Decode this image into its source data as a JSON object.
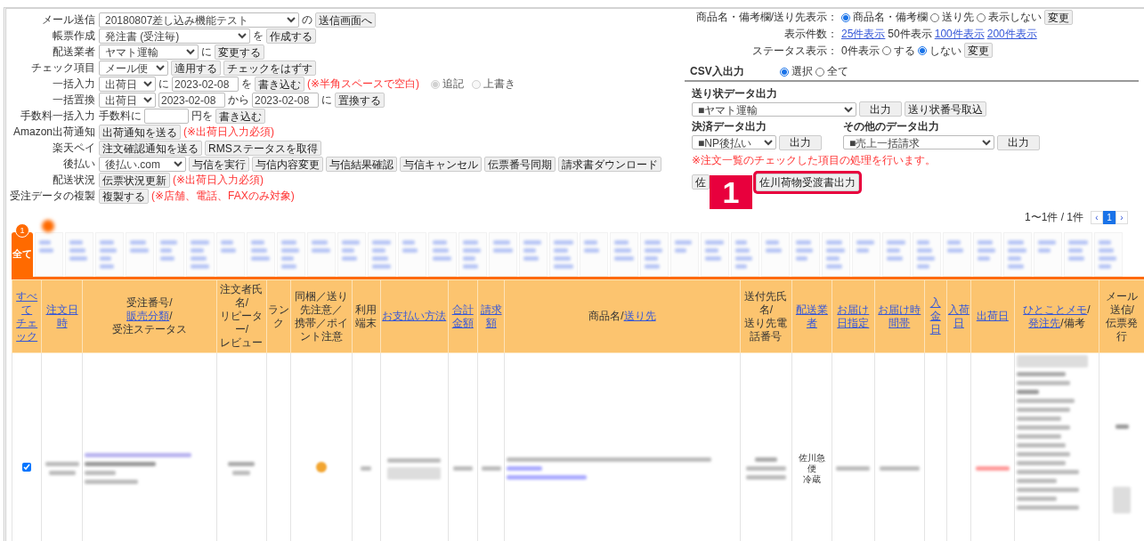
{
  "left_form": [
    {
      "label": "メール送信",
      "items": [
        {
          "kind": "select",
          "value": "20180807差し込み機能テスト"
        },
        {
          "kind": "text",
          "text": "の"
        },
        {
          "kind": "button",
          "text": "送信画面へ"
        }
      ]
    },
    {
      "label": "帳票作成",
      "items": [
        {
          "kind": "select",
          "value": "発注書 (受注毎)"
        },
        {
          "kind": "text",
          "text": "を"
        },
        {
          "kind": "button",
          "text": "作成する"
        }
      ]
    },
    {
      "label": "配送業者",
      "items": [
        {
          "kind": "select",
          "value": "ヤマト運輸"
        },
        {
          "kind": "text",
          "text": "に"
        },
        {
          "kind": "button",
          "text": "変更する"
        }
      ]
    },
    {
      "label": "チェック項目",
      "items": [
        {
          "kind": "select",
          "value": "メール便"
        },
        {
          "kind": "button",
          "text": "適用する"
        },
        {
          "kind": "button",
          "text": "チェックをはずす"
        }
      ]
    },
    {
      "label": "一括入力",
      "items": [
        {
          "kind": "select",
          "value": "出荷日"
        },
        {
          "kind": "text",
          "text": "に"
        },
        {
          "kind": "input",
          "value": "2023-02-08"
        },
        {
          "kind": "text",
          "text": "を"
        },
        {
          "kind": "button",
          "text": "書き込む"
        },
        {
          "kind": "note",
          "text": "(※半角スペースで空白)"
        },
        {
          "kind": "radio",
          "text": "追記",
          "selected": true,
          "disabled": true
        },
        {
          "kind": "radio",
          "text": "上書き",
          "selected": false,
          "disabled": true
        }
      ]
    },
    {
      "label": "一括置換",
      "items": [
        {
          "kind": "select",
          "value": "出荷日"
        },
        {
          "kind": "input",
          "value": "2023-02-08"
        },
        {
          "kind": "text",
          "text": "から"
        },
        {
          "kind": "input",
          "value": "2023-02-08"
        },
        {
          "kind": "text",
          "text": "に"
        },
        {
          "kind": "button",
          "text": "置換する"
        }
      ]
    },
    {
      "label": "手数料一括入力",
      "items": [
        {
          "kind": "text",
          "text": "手数料に"
        },
        {
          "kind": "input"
        },
        {
          "kind": "text",
          "text": "円を"
        },
        {
          "kind": "button",
          "text": "書き込む"
        }
      ]
    },
    {
      "label": "Amazon出荷通知",
      "items": [
        {
          "kind": "button",
          "text": "出荷通知を送る"
        },
        {
          "kind": "note",
          "text": "(※出荷日入力必須)"
        }
      ]
    },
    {
      "label": "楽天ペイ",
      "items": [
        {
          "kind": "button",
          "text": "注文確認通知を送る"
        },
        {
          "kind": "button",
          "text": "RMSステータスを取得"
        }
      ]
    },
    {
      "label": "後払い",
      "items": [
        {
          "kind": "select",
          "value": "後払い.com"
        },
        {
          "kind": "button",
          "text": "与信を実行"
        },
        {
          "kind": "button",
          "text": "与信内容変更"
        },
        {
          "kind": "button",
          "text": "与信結果確認"
        },
        {
          "kind": "button",
          "text": "与信キャンセル"
        },
        {
          "kind": "button",
          "text": "伝票番号同期"
        },
        {
          "kind": "button",
          "text": "請求書ダウンロード"
        }
      ]
    },
    {
      "label": "配送状況",
      "items": [
        {
          "kind": "button",
          "text": "伝票状況更新"
        },
        {
          "kind": "note",
          "text": "(※出荷日入力必須)"
        }
      ]
    },
    {
      "label": "受注データの複製",
      "items": [
        {
          "kind": "button",
          "text": "複製する"
        },
        {
          "kind": "note",
          "text": "(※店舗、電話、FAXのみ対象)"
        }
      ]
    }
  ],
  "display_settings": [
    {
      "label": "商品名・備考欄/送り先表示：",
      "items": [
        {
          "kind": "radio",
          "text": "商品名・備考欄",
          "selected": true
        },
        {
          "kind": "radio",
          "text": "送り先",
          "selected": false
        },
        {
          "kind": "radio",
          "text": "表示しない",
          "selected": false
        },
        {
          "kind": "button",
          "text": "変更"
        }
      ]
    },
    {
      "label": "表示件数：",
      "items": [
        {
          "kind": "link",
          "text": "25件表示"
        },
        {
          "kind": "text",
          "text": "50件表示"
        },
        {
          "kind": "link",
          "text": "100件表示"
        },
        {
          "kind": "link",
          "text": "200件表示"
        }
      ]
    },
    {
      "label": "ステータス表示：",
      "items": [
        {
          "kind": "text",
          "text": "0件表示"
        },
        {
          "kind": "radio",
          "text": "する",
          "selected": false
        },
        {
          "kind": "radio",
          "text": "しない",
          "selected": true
        },
        {
          "kind": "button",
          "text": "変更"
        }
      ]
    }
  ],
  "csv": {
    "title": "CSV入出力",
    "scope": [
      {
        "text": "選択",
        "selected": true
      },
      {
        "text": "全て",
        "selected": false
      }
    ],
    "rows": [
      [
        {
          "title": "送り状データ出力",
          "select": "■ヤマト運輸",
          "buttons": [
            "出力",
            "送り状番号取込"
          ]
        }
      ],
      [
        {
          "title": "決済データ出力",
          "select": "■NP後払い",
          "buttons": [
            "出力"
          ]
        },
        {
          "title": "その他のデータ出力",
          "select": "■売上一括請求",
          "buttons": [
            "出力"
          ]
        }
      ]
    ],
    "note": "※注文一覧のチェックした項目の処理を行います。",
    "buttons": [
      {
        "text": "佐",
        "highlighted": false
      },
      {
        "text": "佐川荷物受渡書出力",
        "highlighted": true
      }
    ]
  },
  "annotation": {
    "number": "1"
  },
  "pager": {
    "summary": "1〜1件 / 1件",
    "pages": [
      {
        "text": "‹",
        "selected": false
      },
      {
        "text": "1",
        "selected": true
      },
      {
        "text": "›",
        "selected": false
      }
    ]
  },
  "tabs": [
    {
      "label": "全て",
      "count": "1",
      "selected": true
    }
  ],
  "table": {
    "columns": [
      {
        "lines": [
          [
            {
              "text": "すべて",
              "link": true
            }
          ],
          [
            {
              "text": "チェック",
              "link": true
            }
          ]
        ]
      },
      {
        "lines": [
          [
            {
              "text": "注文日時",
              "link": true
            }
          ]
        ]
      },
      {
        "lines": [
          [
            {
              "text": "受注番号/",
              "link": false
            }
          ],
          [
            {
              "text": "販売分類",
              "link": true
            },
            {
              "text": "/",
              "link": false
            }
          ],
          [
            {
              "text": "受注ステータス",
              "link": false
            }
          ]
        ]
      },
      {
        "lines": [
          [
            {
              "text": "注文者氏名/",
              "link": false
            }
          ],
          [
            {
              "text": "リピーター/",
              "link": false
            }
          ],
          [
            {
              "text": "レビュー",
              "link": false
            }
          ]
        ]
      },
      {
        "lines": [
          [
            {
              "text": "ランク",
              "link": false
            }
          ]
        ]
      },
      {
        "lines": [
          [
            {
              "text": "同梱／送り先注意／",
              "link": false
            }
          ],
          [
            {
              "text": "携帯／ポイント注意",
              "link": false
            }
          ]
        ]
      },
      {
        "lines": [
          [
            {
              "text": "利用端末",
              "link": false
            }
          ]
        ]
      },
      {
        "lines": [
          [
            {
              "text": "お支払い方法",
              "link": true
            }
          ]
        ]
      },
      {
        "lines": [
          [
            {
              "text": "合計金額",
              "link": true
            }
          ]
        ]
      },
      {
        "lines": [
          [
            {
              "text": "請求額",
              "link": true
            }
          ]
        ]
      },
      {
        "lines": [
          [
            {
              "text": "商品名/",
              "link": false
            },
            {
              "text": "送り先",
              "link": true
            }
          ]
        ]
      },
      {
        "lines": [
          [
            {
              "text": "送付先氏名/",
              "link": false
            }
          ],
          [
            {
              "text": "送り先電話番号",
              "link": false
            }
          ]
        ]
      },
      {
        "lines": [
          [
            {
              "text": "配送業者",
              "link": true
            }
          ]
        ]
      },
      {
        "lines": [
          [
            {
              "text": "お届け日指定",
              "link": true
            }
          ]
        ]
      },
      {
        "lines": [
          [
            {
              "text": "お届け時間帯",
              "link": true
            }
          ]
        ]
      },
      {
        "lines": [
          [
            {
              "text": "入金日",
              "link": true
            }
          ]
        ]
      },
      {
        "lines": [
          [
            {
              "text": "入荷日",
              "link": true
            }
          ]
        ]
      },
      {
        "lines": [
          [
            {
              "text": "出荷日",
              "link": true
            }
          ]
        ]
      },
      {
        "lines": [
          [
            {
              "text": "ひとことメモ",
              "link": true
            },
            {
              "text": "/",
              "link": false
            },
            {
              "text": "発注先",
              "link": true
            },
            {
              "text": "/備考",
              "link": false
            }
          ]
        ]
      },
      {
        "lines": [
          [
            {
              "text": "メール送信/",
              "link": false
            }
          ],
          [
            {
              "text": "伝票発行",
              "link": false
            }
          ]
        ]
      }
    ],
    "rows": [
      {
        "checked": true,
        "carrier": [
          "佐川急便",
          "冷蔵"
        ]
      }
    ]
  }
}
